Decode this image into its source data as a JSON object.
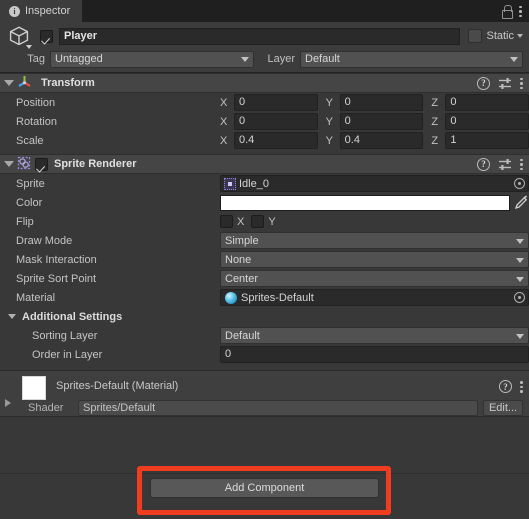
{
  "window": {
    "tab_label": "Inspector",
    "tab_icon": "info-icon",
    "lock_icon": "lock-icon",
    "menu_icon": "kebab-menu-icon"
  },
  "gameobject": {
    "icon": "cube-icon",
    "enabled": true,
    "name": "Player",
    "name_placeholder": "Name",
    "static_label": "Static",
    "static_checked": false,
    "tag_label": "Tag",
    "tag_value": "Untagged",
    "layer_label": "Layer",
    "layer_value": "Default"
  },
  "transform": {
    "title": "Transform",
    "icon": "transform-axis-icon",
    "help_icon": "help-icon",
    "preset_icon": "preset-slider-icon",
    "menu_icon": "kebab-menu-icon",
    "rows": [
      {
        "label": "Position",
        "x": "0",
        "y": "0",
        "z": "0"
      },
      {
        "label": "Rotation",
        "x": "0",
        "y": "0",
        "z": "0"
      },
      {
        "label": "Scale",
        "x": "0.4",
        "y": "0.4",
        "z": "1"
      }
    ],
    "axis_x": "X",
    "axis_y": "Y",
    "axis_z": "Z"
  },
  "sprite_renderer": {
    "title": "Sprite Renderer",
    "icon": "sprite-renderer-icon",
    "enabled": true,
    "help_icon": "help-icon",
    "preset_icon": "preset-slider-icon",
    "menu_icon": "kebab-menu-icon",
    "sprite_label": "Sprite",
    "sprite_value": "Idle_0",
    "sprite_icon": "sprite-asset-icon",
    "color_label": "Color",
    "color_value": "#FFFFFF",
    "eyedropper_icon": "eyedropper-icon",
    "flip_label": "Flip",
    "flip_x_label": "X",
    "flip_y_label": "Y",
    "flip_x_checked": false,
    "flip_y_checked": false,
    "draw_mode_label": "Draw Mode",
    "draw_mode_value": "Simple",
    "mask_interaction_label": "Mask Interaction",
    "mask_interaction_value": "None",
    "sprite_sort_point_label": "Sprite Sort Point",
    "sprite_sort_point_value": "Center",
    "material_label": "Material",
    "material_value": "Sprites-Default",
    "material_icon": "material-sphere-icon",
    "additional_settings_label": "Additional Settings",
    "sorting_layer_label": "Sorting Layer",
    "sorting_layer_value": "Default",
    "order_in_layer_label": "Order in Layer",
    "order_in_layer_value": "0"
  },
  "material_preview": {
    "title": "Sprites-Default (Material)",
    "swatch_color": "#FFFFFF",
    "shader_label": "Shader",
    "shader_value": "Sprites/Default",
    "edit_label": "Edit...",
    "help_icon": "help-icon",
    "menu_icon": "kebab-menu-icon",
    "foldout_icon": "triangle-right-icon"
  },
  "footer": {
    "add_component_label": "Add Component",
    "highlight_color": "#F23C20"
  }
}
